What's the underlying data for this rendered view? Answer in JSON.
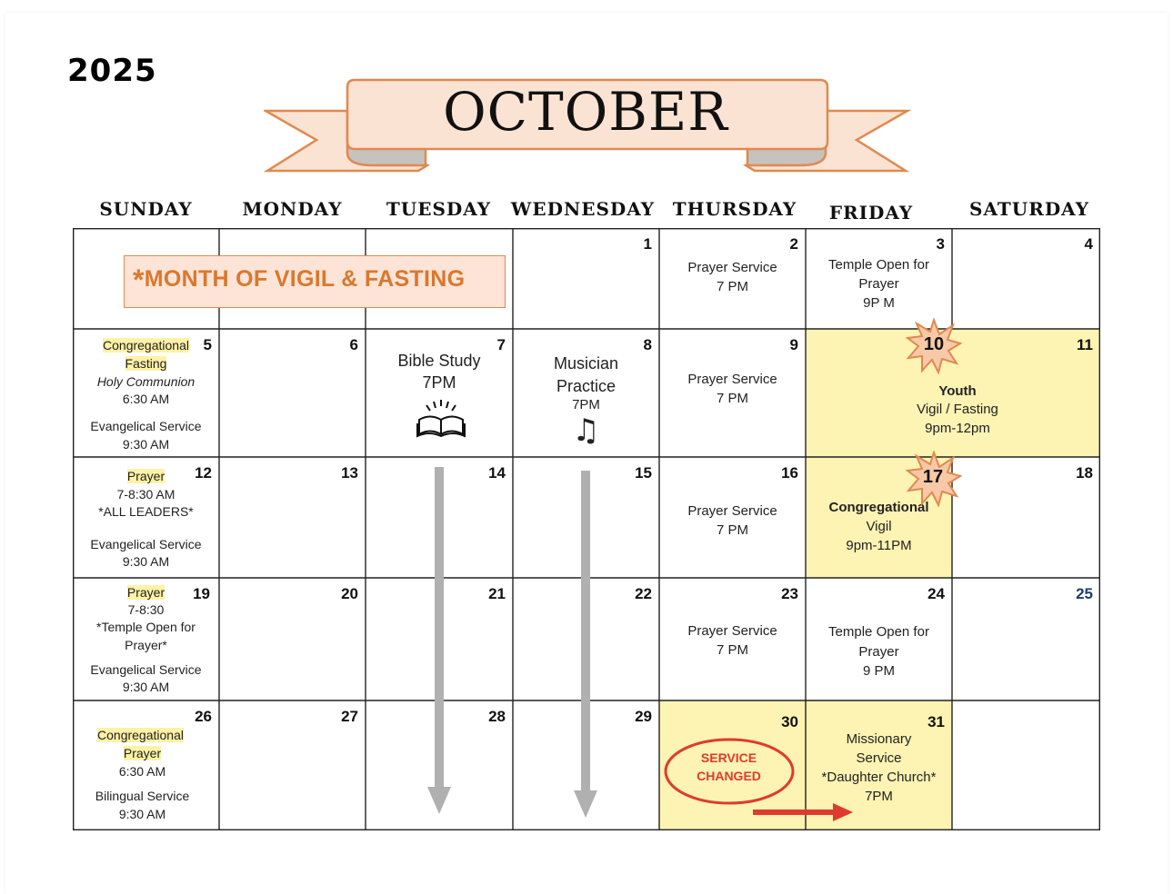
{
  "year": "2025",
  "month": "OCTOBER",
  "days_of_week": [
    "SUNDAY",
    "MONDAY",
    "TUESDAY",
    "WEDNESDAY",
    "THURSDAY",
    "FRIDAY",
    "SATURDAY"
  ],
  "banner_note": {
    "star": "*",
    "text": "MONTH OF VIGIL & FASTING"
  },
  "colors": {
    "highlight": "#fdf2a6",
    "cell_yellow": "#fdf3b3",
    "banner_fill": "#fde4d6",
    "banner_stroke": "#e0894f",
    "accent_orange": "#d9782e",
    "red": "#e03a2e",
    "arrow_gray": "#b0b0b0"
  },
  "cells": {
    "d1": "1",
    "d2": {
      "num": "2",
      "l1": "Prayer Service",
      "l2": "7 PM"
    },
    "d3": {
      "num": "3",
      "l1": "Temple Open for",
      "l2": "Prayer",
      "l3": "9P M"
    },
    "d4": "4",
    "d5": {
      "num": "5",
      "l1": "Congregational",
      "l2": "Fasting",
      "l3": "Holy Communion",
      "l4": "6:30 AM",
      "l5": "Evangelical Service",
      "l6": "9:30 AM"
    },
    "d6": "6",
    "d7": {
      "num": "7",
      "l1": "Bible Study",
      "l2": "7PM",
      "icon": "open-book-icon"
    },
    "d8": {
      "num": "8",
      "l1": "Musician",
      "l2": "Practice",
      "l3": "7PM",
      "icon": "music-notes-icon",
      "glyph": "♫"
    },
    "d9": {
      "num": "9",
      "l1": "Prayer Service",
      "l2": "7 PM"
    },
    "d10": "10",
    "d11": "11",
    "youth": {
      "l1": "Youth",
      "l2": "Vigil / Fasting",
      "l3": "9pm-12pm"
    },
    "d12": {
      "num": "12",
      "l1": "Prayer",
      "l2": "7-8:30 AM",
      "l3": "*ALL LEADERS*",
      "l4": "Evangelical Service",
      "l5": "9:30 AM"
    },
    "d13": "13",
    "d14": "14",
    "d15": "15",
    "d16": {
      "num": "16",
      "l1": "Prayer Service",
      "l2": "7 PM"
    },
    "d17": {
      "num": "17",
      "l1": "Congregational",
      "l2": "Vigil",
      "l3": "9pm-11PM"
    },
    "d18": "18",
    "d19": {
      "num": "19",
      "l1": "Prayer",
      "l2": "7-8:30",
      "l3": "*Temple Open for",
      "l4": "Prayer*",
      "l5": "Evangelical Service",
      "l6": "9:30 AM"
    },
    "d20": "20",
    "d21": "21",
    "d22": "22",
    "d23": {
      "num": "23",
      "l1": "Prayer Service",
      "l2": "7 PM"
    },
    "d24": {
      "num": "24",
      "l1": "Temple Open for",
      "l2": "Prayer",
      "l3": "9 PM"
    },
    "d25": "25",
    "d26": {
      "num": "26",
      "l1": "Congregational",
      "l2": "Prayer",
      "l3": "6:30 AM",
      "l4": "Bilingual Service",
      "l5": "9:30 AM"
    },
    "d27": "27",
    "d28": "28",
    "d29": "29",
    "d30": {
      "num": "30",
      "stamp1": "SERVICE",
      "stamp2": "CHANGED"
    },
    "d31": {
      "num": "31",
      "l1": "Missionary",
      "l2": "Service",
      "l3": "*Daughter Church*",
      "l4": "7PM"
    }
  }
}
